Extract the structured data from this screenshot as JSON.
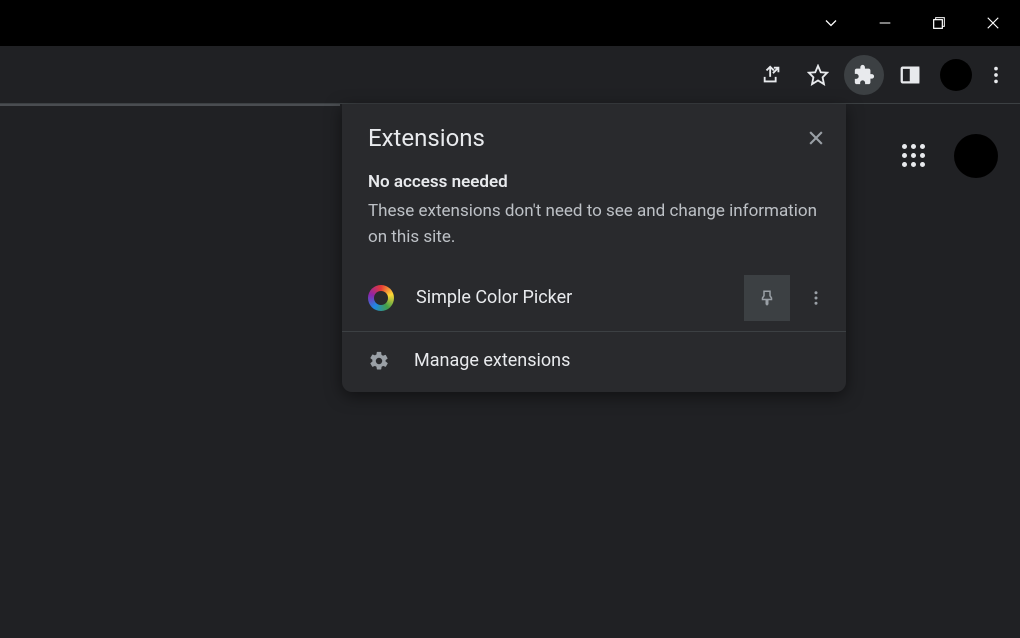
{
  "window": {
    "controls": [
      "chevron-down",
      "minimize",
      "maximize",
      "close"
    ]
  },
  "toolbar": {
    "icons": [
      "share",
      "bookmark",
      "extensions",
      "side-panel",
      "avatar",
      "kebab"
    ]
  },
  "extensions_popup": {
    "title": "Extensions",
    "no_access_header": "No access needed",
    "no_access_body": "These extensions don't need to see and change information on this site.",
    "items": [
      {
        "name": "Simple Color Picker",
        "icon": "color-ring"
      }
    ],
    "manage_label": "Manage extensions"
  }
}
